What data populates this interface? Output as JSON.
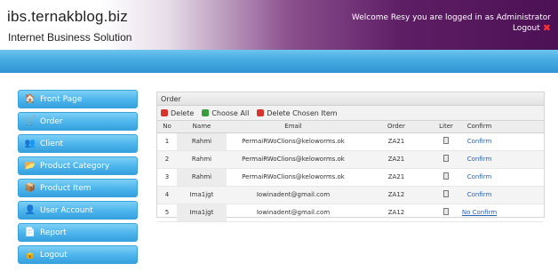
{
  "header": {
    "site_title": "ibs.ternakblog.biz",
    "site_subtitle": "Internet Business Solution",
    "welcome_text": "Welcome Resy you are logged in as Administrator",
    "logout_label": "Logout"
  },
  "menu": {
    "items": [
      {
        "label": "Front Page",
        "icon": "home-icon"
      },
      {
        "label": "Order",
        "icon": "cart-icon"
      },
      {
        "label": "Client",
        "icon": "client-icon"
      },
      {
        "label": "Product Category",
        "icon": "category-icon"
      },
      {
        "label": "Product Item",
        "icon": "product-icon"
      },
      {
        "label": "User Account",
        "icon": "user-icon"
      },
      {
        "label": "Report",
        "icon": "report-icon"
      },
      {
        "label": "Logout",
        "icon": "logout-icon"
      }
    ]
  },
  "panel": {
    "title": "Order",
    "toolbar": {
      "delete_label": "Delete",
      "choose_all_label": "Choose All",
      "delete_chosen_label": "Delete Chosen Item"
    },
    "columns": [
      "No",
      "Name",
      "Email",
      "Order",
      "Liter",
      "Confirm"
    ],
    "rows": [
      {
        "no": "1",
        "name": "Rahmi",
        "email": "PermaiRWoClions@keloworms.ok",
        "order": "ZA21",
        "confirm": "Confirm"
      },
      {
        "no": "2",
        "name": "Rahmi",
        "email": "PermaiRWoClions@keloworms.ok",
        "order": "ZA21",
        "confirm": "Confirm"
      },
      {
        "no": "3",
        "name": "Rahmi",
        "email": "PermaiRWoClions@keloworms.ok",
        "order": "ZA21",
        "confirm": "Confirm"
      },
      {
        "no": "4",
        "name": "Ima1jgt",
        "email": "Iowinadent@gmail.com",
        "order": "ZA12",
        "confirm": "Confirm"
      },
      {
        "no": "5",
        "name": "Ima1jgt",
        "email": "Iowinadent@gmail.com",
        "order": "ZA12",
        "confirm": "No Confirm"
      }
    ]
  }
}
